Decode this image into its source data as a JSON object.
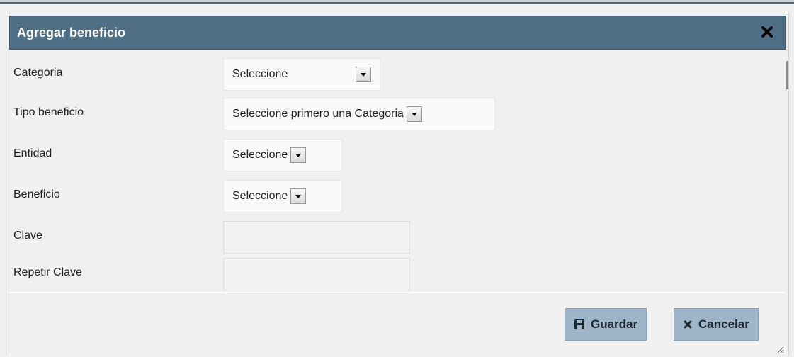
{
  "dialog": {
    "title": "Agregar beneficio",
    "close_icon": "close-icon"
  },
  "form": {
    "categoria": {
      "label": "Categoria",
      "value": "Seleccione"
    },
    "tipo_beneficio": {
      "label": "Tipo beneficio",
      "value": "Seleccione primero una Categoria"
    },
    "entidad": {
      "label": "Entidad",
      "value": "Seleccione"
    },
    "beneficio": {
      "label": "Beneficio",
      "value": "Seleccione"
    },
    "clave": {
      "label": "Clave",
      "value": ""
    },
    "repetir_clave": {
      "label": "Repetir Clave",
      "value": ""
    }
  },
  "buttons": {
    "guardar": {
      "label": "Guardar",
      "icon": "save-icon"
    },
    "cancelar": {
      "label": "Cancelar",
      "icon": "x-icon"
    }
  },
  "colors": {
    "titlebar": "#4f6f87",
    "button": "#9eb4c8"
  }
}
